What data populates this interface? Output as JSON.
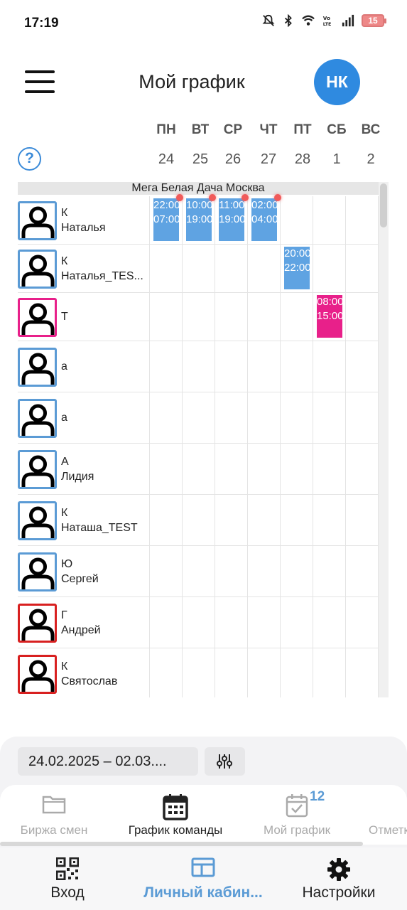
{
  "status_bar": {
    "time": "17:19",
    "battery": "15"
  },
  "header": {
    "title": "Мой график",
    "avatar_initials": "НК"
  },
  "days": [
    {
      "name": "ПН",
      "num": "24"
    },
    {
      "name": "ВТ",
      "num": "25"
    },
    {
      "name": "СР",
      "num": "26"
    },
    {
      "name": "ЧТ",
      "num": "27"
    },
    {
      "name": "ПТ",
      "num": "28"
    },
    {
      "name": "СБ",
      "num": "1"
    },
    {
      "name": "ВС",
      "num": "2"
    }
  ],
  "help_label": "?",
  "location": "Мега Белая Дача Москва",
  "people": [
    {
      "line1": "К",
      "line2": "Наталья",
      "frame_color": "#5b9bd5"
    },
    {
      "line1": "К",
      "line2": "Наталья_TES...",
      "frame_color": "#5b9bd5"
    },
    {
      "line1": "Т",
      "line2": "",
      "frame_color": "#e8208a"
    },
    {
      "line1": "а",
      "line2": "",
      "frame_color": "#5b9bd5"
    },
    {
      "line1": "а",
      "line2": "",
      "frame_color": "#5b9bd5"
    },
    {
      "line1": "А",
      "line2": "Лидия",
      "frame_color": "#5b9bd5"
    },
    {
      "line1": "К",
      "line2": "Наташа_TEST",
      "frame_color": "#5b9bd5"
    },
    {
      "line1": "Ю",
      "line2": "Сергей",
      "frame_color": "#5b9bd5"
    },
    {
      "line1": "Г",
      "line2": "Андрей",
      "frame_color": "#d82020"
    },
    {
      "line1": "К",
      "line2": "Святослав",
      "frame_color": "#d82020"
    }
  ],
  "shifts": [
    {
      "row": 0,
      "day": 0,
      "start": "22:00",
      "end": "07:00",
      "color": "blue",
      "alert": true
    },
    {
      "row": 0,
      "day": 1,
      "start": "10:00",
      "end": "19:00",
      "color": "blue",
      "alert": true
    },
    {
      "row": 0,
      "day": 2,
      "start": "11:00",
      "end": "19:00",
      "color": "blue",
      "alert": true
    },
    {
      "row": 0,
      "day": 3,
      "start": "02:00",
      "end": "04:00",
      "color": "blue",
      "alert": true
    },
    {
      "row": 1,
      "day": 4,
      "start": "20:00",
      "end": "22:00",
      "color": "blue",
      "alert": false
    },
    {
      "row": 2,
      "day": 5,
      "start": "08:00",
      "end": "15:00",
      "color": "pink",
      "alert": false
    }
  ],
  "filters": {
    "date_range": "24.02.2025 – 02.03...."
  },
  "tabs": [
    {
      "label": "Биржа смен",
      "icon": "folder-icon",
      "active": false
    },
    {
      "label": "График команды",
      "icon": "calendar-icon",
      "active": true
    },
    {
      "label": "Мой график",
      "icon": "calendar-check-icon",
      "active": false,
      "badge": "12"
    },
    {
      "label": "Отметк",
      "icon": "person-icon",
      "active": false
    }
  ],
  "bottom_nav": [
    {
      "label": "Вход",
      "icon": "qr-code-icon",
      "active": false
    },
    {
      "label": "Личный кабин...",
      "icon": "dashboard-icon",
      "active": true
    },
    {
      "label": "Настройки",
      "icon": "gear-icon",
      "active": false
    }
  ]
}
